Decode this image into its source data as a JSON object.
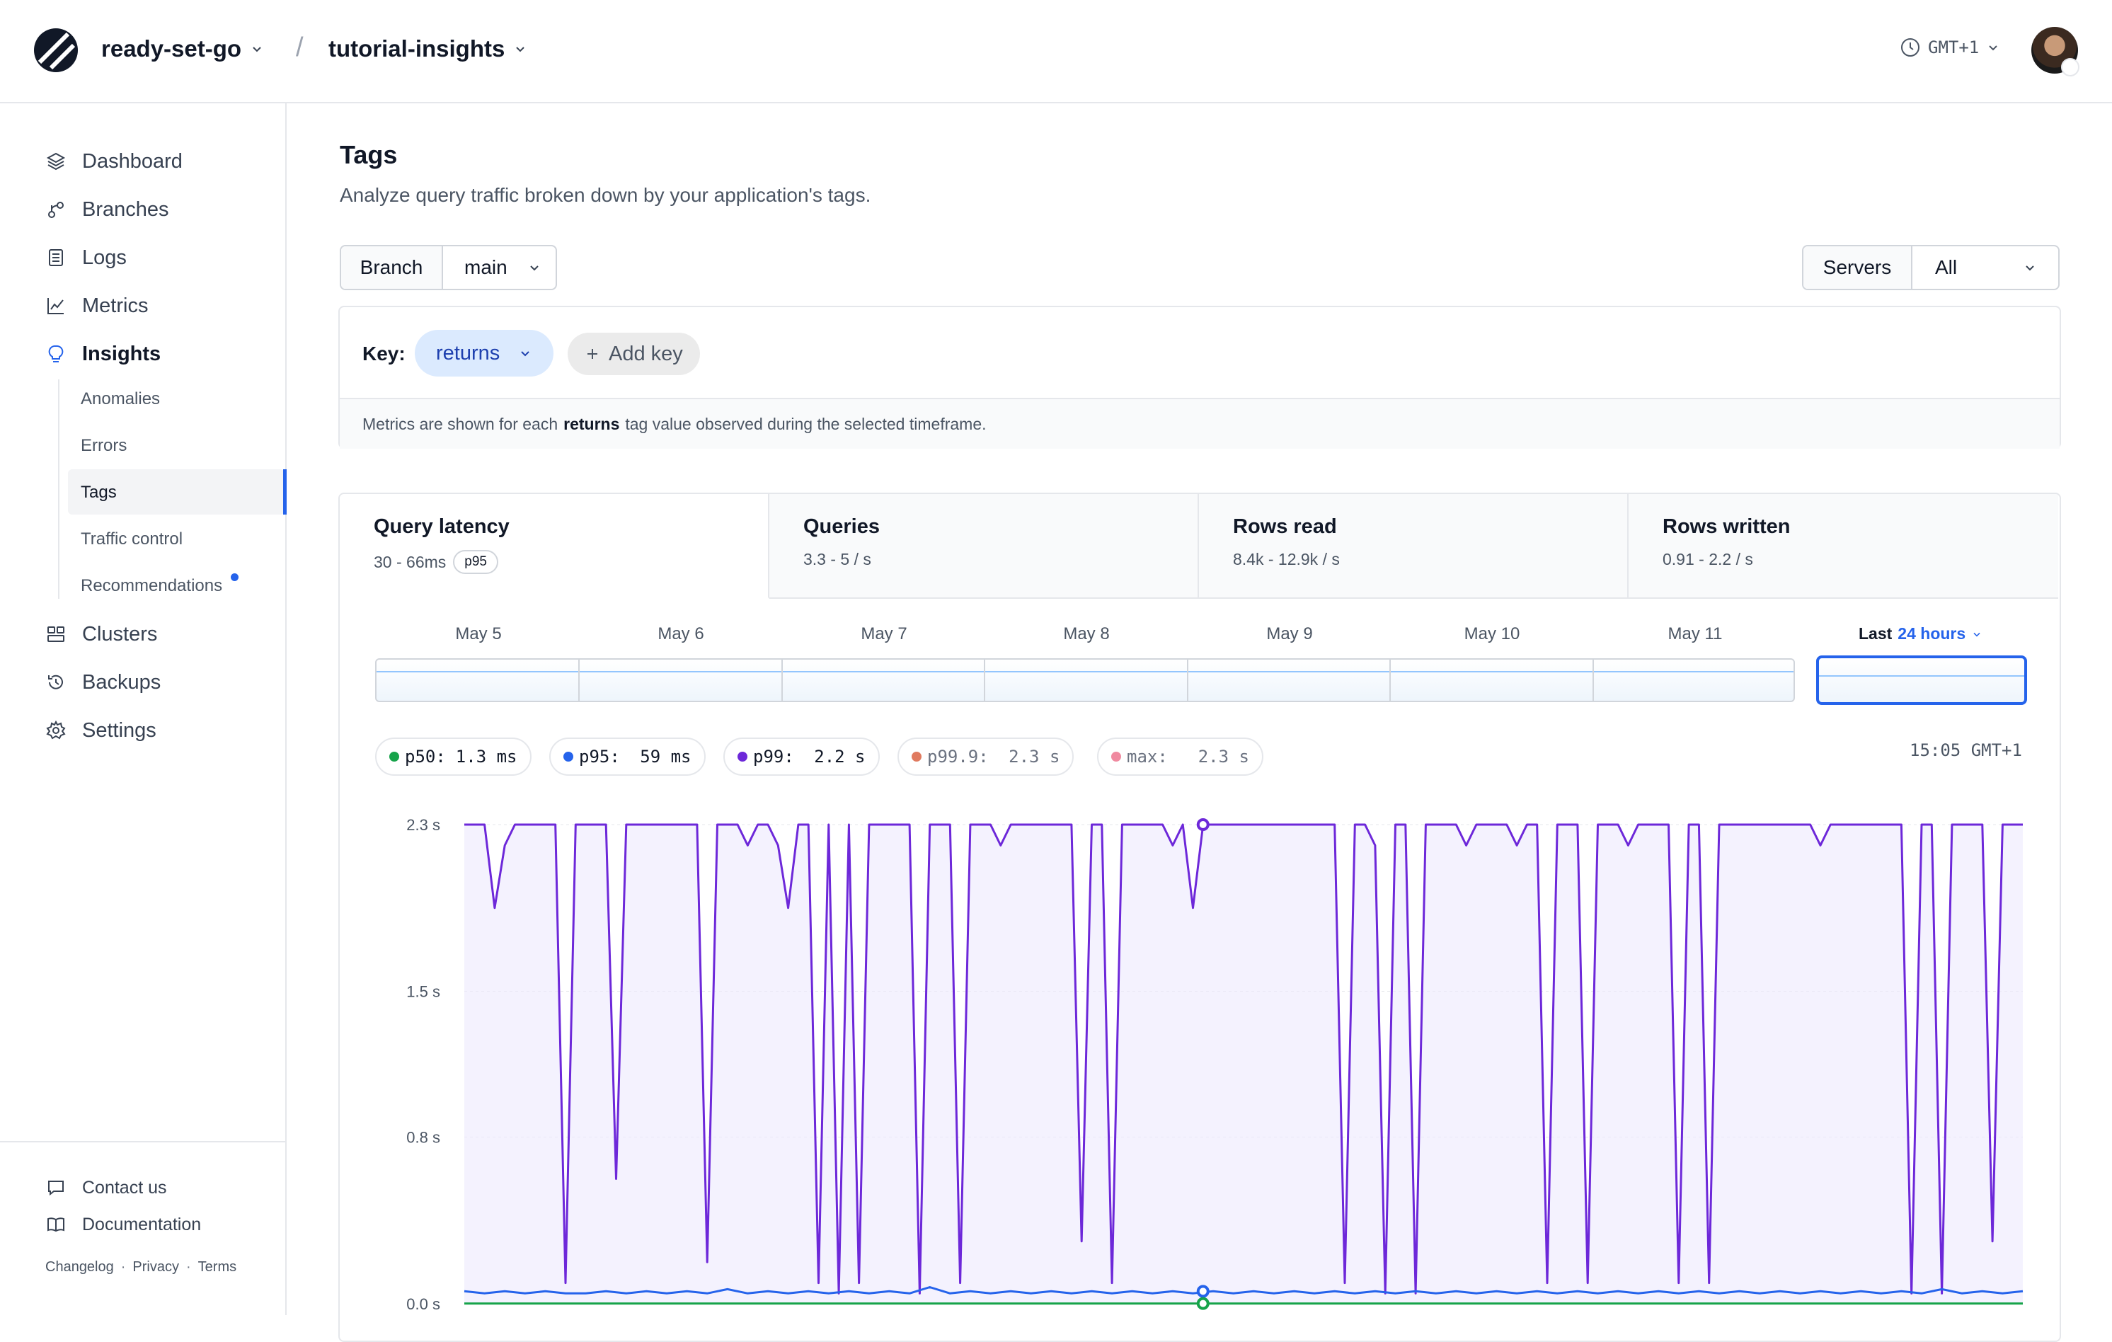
{
  "header": {
    "org": "ready-set-go",
    "database": "tutorial-insights",
    "separator": "/",
    "timezone": "GMT+1"
  },
  "sidebar": {
    "items": [
      {
        "label": "Dashboard",
        "icon": "layers-icon"
      },
      {
        "label": "Branches",
        "icon": "branch-icon"
      },
      {
        "label": "Logs",
        "icon": "logs-icon"
      },
      {
        "label": "Metrics",
        "icon": "metrics-icon"
      },
      {
        "label": "Insights",
        "icon": "bulb-icon",
        "active": true
      },
      {
        "label": "Clusters",
        "icon": "clusters-icon"
      },
      {
        "label": "Backups",
        "icon": "backups-icon"
      },
      {
        "label": "Settings",
        "icon": "gear-icon"
      }
    ],
    "sub_items": [
      "Anomalies",
      "Errors",
      "Tags",
      "Traffic control",
      "Recommendations"
    ],
    "active_sub": "Tags",
    "footer": {
      "contact": "Contact us",
      "docs": "Documentation",
      "links": [
        "Changelog",
        "Privacy",
        "Terms"
      ],
      "link_sep": "·"
    }
  },
  "page": {
    "title": "Tags",
    "subtitle": "Analyze query traffic broken down by your application's tags."
  },
  "filters": {
    "branch_label": "Branch",
    "branch_value": "main",
    "servers_label": "Servers",
    "servers_value": "All"
  },
  "key_panel": {
    "label": "Key:",
    "selected_key": "returns",
    "add_key": "Add key",
    "note_prefix": "Metrics are shown for each",
    "note_key": "returns",
    "note_suffix": "tag value observed during the selected timeframe."
  },
  "tabs": [
    {
      "title": "Query latency",
      "sub": "30 - 66ms",
      "badge": "p95"
    },
    {
      "title": "Queries",
      "sub": "3.3 - 5 / s"
    },
    {
      "title": "Rows read",
      "sub": "8.4k - 12.9k / s"
    },
    {
      "title": "Rows written",
      "sub": "0.91 - 2.2 / s"
    }
  ],
  "timeline": {
    "dates": [
      "May 5",
      "May 6",
      "May 7",
      "May 8",
      "May 9",
      "May 10",
      "May 11"
    ],
    "last_prefix": "Last",
    "last_range": "24 hours"
  },
  "legend": [
    {
      "label": "p50:",
      "value": "1.3 ms",
      "color": "#16a34a"
    },
    {
      "label": "p95:",
      "value": " 59 ms",
      "color": "#2563eb"
    },
    {
      "label": "p99:",
      "value": " 2.2 s",
      "color": "#6d28d9"
    },
    {
      "label": "p99.9:",
      "value": " 2.3 s",
      "color": "#e07a5f",
      "faded": true
    },
    {
      "label": "max:",
      "value": "  2.3 s",
      "color": "#f08aa0",
      "faded": true
    }
  ],
  "timestamp": "15:05 GMT+1",
  "colors": {
    "accent": "#2563eb",
    "p99_line": "#6d28d9",
    "p95_line": "#2563eb",
    "p50_line": "#16a34a",
    "area_fill": "#ede9fe"
  },
  "chart_data": {
    "type": "line",
    "y_ticks": [
      "2.3 s",
      "1.5 s",
      "0.8 s",
      "0.0 s"
    ],
    "ylim": [
      0,
      2.3
    ],
    "unit": "s",
    "series": [
      {
        "name": "p99",
        "values": [
          2.3,
          2.3,
          2.3,
          1.9,
          2.2,
          2.3,
          2.3,
          2.3,
          2.3,
          2.3,
          0.1,
          2.3,
          2.3,
          2.3,
          2.3,
          0.6,
          2.3,
          2.3,
          2.3,
          2.3,
          2.3,
          2.3,
          2.3,
          2.3,
          0.2,
          2.3,
          2.3,
          2.3,
          2.2,
          2.3,
          2.3,
          2.2,
          1.9,
          2.3,
          2.3,
          0.1,
          2.3,
          0.05,
          2.3,
          0.1,
          2.3,
          2.3,
          2.3,
          2.3,
          2.3,
          0.05,
          2.3,
          2.3,
          2.3,
          0.1,
          2.3,
          2.3,
          2.3,
          2.2,
          2.3,
          2.3,
          2.3,
          2.3,
          2.3,
          2.3,
          2.3,
          0.3,
          2.3,
          2.3,
          0.1,
          2.3,
          2.3,
          2.3,
          2.3,
          2.3,
          2.2,
          2.3,
          1.9,
          2.3,
          2.3,
          2.3,
          2.3,
          2.3,
          2.3,
          2.3,
          2.3,
          2.3,
          2.3,
          2.3,
          2.3,
          2.3,
          2.3,
          0.1,
          2.3,
          2.3,
          2.2,
          0.05,
          2.3,
          2.3,
          0.05,
          2.3,
          2.3,
          2.3,
          2.3,
          2.2,
          2.3,
          2.3,
          2.3,
          2.3,
          2.2,
          2.3,
          2.3,
          0.1,
          2.3,
          2.3,
          2.3,
          0.1,
          2.3,
          2.3,
          2.3,
          2.2,
          2.3,
          2.3,
          2.3,
          2.3,
          0.1,
          2.3,
          2.3,
          0.1,
          2.3,
          2.3,
          2.3,
          2.3,
          2.3,
          2.3,
          2.3,
          2.3,
          2.3,
          2.3,
          2.2,
          2.3,
          2.3,
          2.3,
          2.3,
          2.3,
          2.3,
          2.3,
          2.3,
          0.05,
          2.3,
          2.3,
          0.05,
          2.3,
          2.3,
          2.3,
          2.3,
          0.3,
          2.3,
          2.3,
          2.3
        ],
        "color": "#6d28d9"
      },
      {
        "name": "p95",
        "values": [
          0.06,
          0.05,
          0.06,
          0.05,
          0.06,
          0.05,
          0.05,
          0.06,
          0.05,
          0.06,
          0.05,
          0.06,
          0.05,
          0.07,
          0.05,
          0.06,
          0.05,
          0.06,
          0.05,
          0.06,
          0.05,
          0.06,
          0.05,
          0.08,
          0.05,
          0.06,
          0.05,
          0.06,
          0.05,
          0.06,
          0.05,
          0.06,
          0.05,
          0.06,
          0.05,
          0.06,
          0.05,
          0.06,
          0.05,
          0.06,
          0.05,
          0.06,
          0.05,
          0.06,
          0.05,
          0.06,
          0.05,
          0.06,
          0.05,
          0.06,
          0.05,
          0.06,
          0.05,
          0.06,
          0.05,
          0.06,
          0.05,
          0.06,
          0.05,
          0.06,
          0.05,
          0.06,
          0.05,
          0.06,
          0.05,
          0.06,
          0.05,
          0.06,
          0.05,
          0.06,
          0.05,
          0.06,
          0.05,
          0.07,
          0.05,
          0.06,
          0.05,
          0.06
        ],
        "color": "#2563eb"
      },
      {
        "name": "p50",
        "values": [
          0.0013,
          0.0013,
          0.0013,
          0.0013,
          0.0013,
          0.0013,
          0.0013,
          0.0013,
          0.0013,
          0.0013
        ],
        "color": "#16a34a"
      }
    ]
  }
}
